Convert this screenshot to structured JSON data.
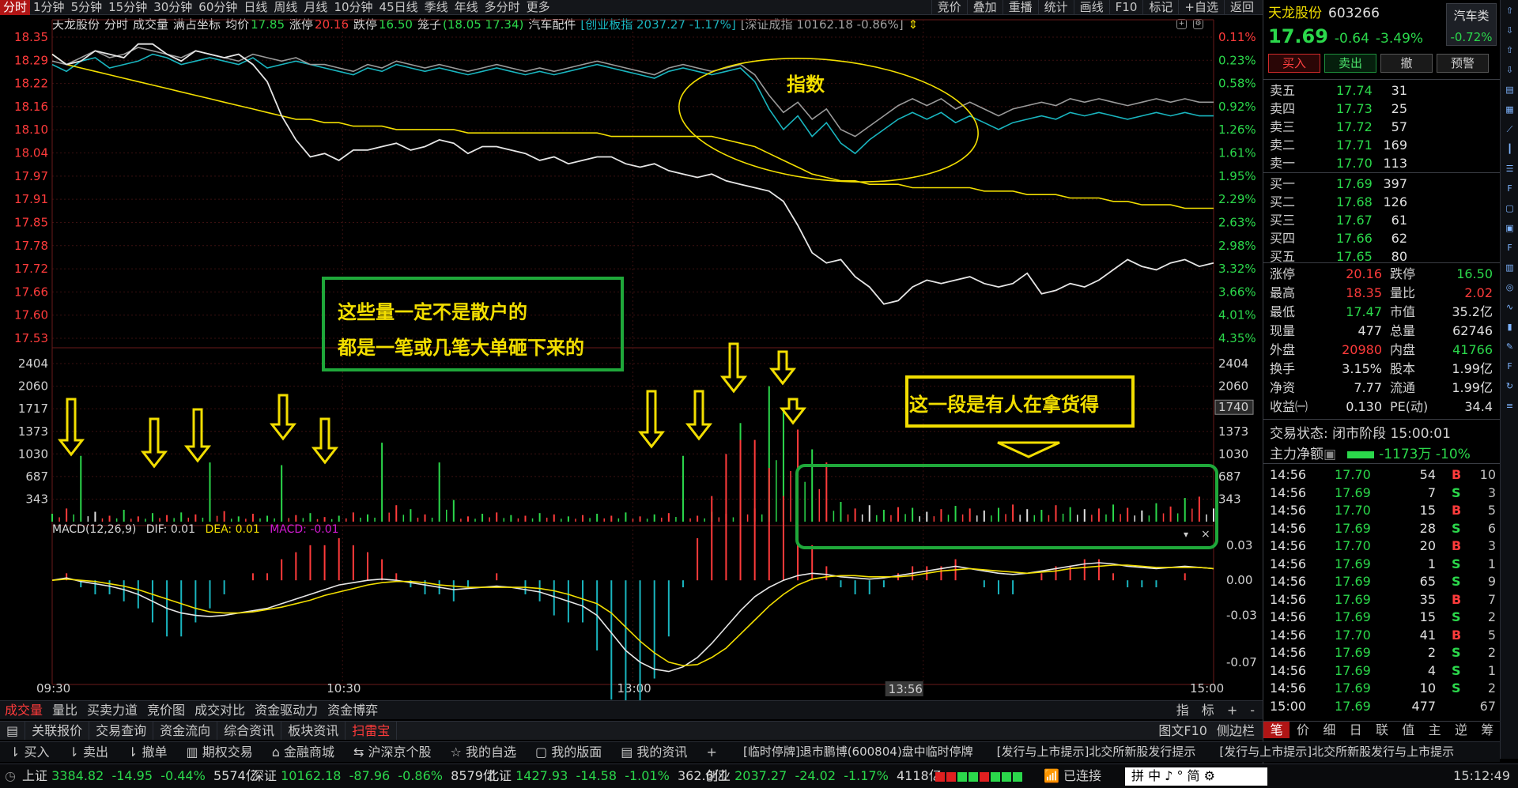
{
  "toolbar": {
    "periods": [
      "分时",
      "1分钟",
      "5分钟",
      "15分钟",
      "30分钟",
      "60分钟",
      "日线",
      "周线",
      "月线",
      "10分钟",
      "45日线",
      "季线",
      "年线",
      "多分时",
      "更多"
    ],
    "active_period": "分时",
    "right_tools": [
      "竞价",
      "叠加",
      "重播",
      "统计",
      "画线",
      "F10",
      "标记",
      "+自选",
      "返回"
    ]
  },
  "info_bar": {
    "stock_name": "天龙股份",
    "mode": "分时",
    "volume_label": "成交量",
    "coord_mode": "满占坐标",
    "avg_label": "均价",
    "avg_value": "17.85",
    "limit_up_label": "涨停",
    "limit_up_value": "20.16",
    "limit_down_label": "跌停",
    "limit_down_value": "16.50",
    "cage_label": "笼子",
    "cage_value": "(18.05 17.34)",
    "sector": "汽车配件",
    "index1": "[创业板指 2037.27 -1.17%]",
    "index2": "[深证成指 10162.18 -0.86%]"
  },
  "chart_data": {
    "type": "line",
    "title": "",
    "price_axis_left": [
      "18.35",
      "18.29",
      "18.22",
      "18.16",
      "18.10",
      "18.04",
      "17.97",
      "17.91",
      "17.85",
      "17.78",
      "17.72",
      "17.66",
      "17.60",
      "17.53"
    ],
    "price_axis_right": [
      "0.11%",
      "0.23%",
      "0.58%",
      "0.92%",
      "1.26%",
      "1.61%",
      "1.95%",
      "2.29%",
      "2.63%",
      "2.98%",
      "3.32%",
      "3.66%",
      "4.01%",
      "4.35%"
    ],
    "volume_axis": [
      "2404",
      "2060",
      "1717",
      "1373",
      "1030",
      "687",
      "343"
    ],
    "volume_cursor": "1740",
    "macd_axis": [
      "0.03",
      "0.00",
      "-0.03",
      "-0.07"
    ],
    "time_axis": [
      "09:30",
      "10:30",
      "13:00",
      "15:00"
    ],
    "cursor_time": "13:56",
    "series": [
      {
        "name": "price",
        "color": "#e6e6e6",
        "values": [
          18.3,
          18.27,
          18.28,
          18.31,
          18.3,
          18.29,
          18.33,
          18.33,
          18.3,
          18.28,
          18.31,
          18.3,
          18.29,
          18.3,
          18.27,
          18.22,
          18.12,
          18.05,
          18.0,
          18.01,
          17.99,
          18.02,
          18.02,
          18.03,
          18.04,
          18.02,
          18.03,
          18.05,
          18.04,
          18.01,
          18.03,
          18.03,
          18.02,
          18.01,
          17.99,
          18.0,
          17.98,
          17.99,
          18.0,
          18.0,
          17.98,
          17.97,
          17.98,
          17.96,
          17.95,
          17.94,
          17.95,
          17.93,
          17.92,
          17.91,
          17.9,
          17.87,
          17.8,
          17.72,
          17.69,
          17.7,
          17.65,
          17.62,
          17.57,
          17.58,
          17.62,
          17.64,
          17.63,
          17.64,
          17.65,
          17.63,
          17.62,
          17.63,
          17.66,
          17.6,
          17.61,
          17.63,
          17.62,
          17.64,
          17.67,
          17.7,
          17.68,
          17.67,
          17.69,
          17.7,
          17.68,
          17.69
        ]
      },
      {
        "name": "avg",
        "color": "#f2de00",
        "values": [
          18.3,
          18.27,
          18.26,
          18.25,
          18.24,
          18.23,
          18.22,
          18.21,
          18.2,
          18.19,
          18.18,
          18.17,
          18.16,
          18.15,
          18.14,
          18.13,
          18.12,
          18.11,
          18.11,
          18.1,
          18.1,
          18.09,
          18.09,
          18.09,
          18.08,
          18.08,
          18.08,
          18.08,
          18.08,
          18.07,
          18.07,
          18.07,
          18.07,
          18.07,
          18.07,
          18.07,
          18.07,
          18.07,
          18.07,
          18.06,
          18.06,
          18.06,
          18.06,
          18.06,
          18.06,
          18.06,
          18.06,
          18.05,
          18.04,
          18.03,
          18.01,
          17.99,
          17.97,
          17.95,
          17.94,
          17.93,
          17.93,
          17.92,
          17.92,
          17.92,
          17.91,
          17.91,
          17.91,
          17.91,
          17.91,
          17.9,
          17.9,
          17.9,
          17.89,
          17.89,
          17.89,
          17.88,
          17.88,
          17.88,
          17.87,
          17.87,
          17.86,
          17.86,
          17.86,
          17.85,
          17.85,
          17.85
        ]
      },
      {
        "name": "index1",
        "color": "#19b5bf",
        "values": [
          18.27,
          18.25,
          18.28,
          18.29,
          18.26,
          18.27,
          18.28,
          18.3,
          18.29,
          18.27,
          18.28,
          18.29,
          18.28,
          18.27,
          18.29,
          18.26,
          18.27,
          18.28,
          18.27,
          18.26,
          18.25,
          18.24,
          18.26,
          18.25,
          18.27,
          18.26,
          18.25,
          18.26,
          18.25,
          18.24,
          18.25,
          18.26,
          18.25,
          18.24,
          18.25,
          18.24,
          18.25,
          18.26,
          18.27,
          18.26,
          18.25,
          18.24,
          18.23,
          18.25,
          18.26,
          18.25,
          18.24,
          18.25,
          18.26,
          18.22,
          18.14,
          18.08,
          18.12,
          18.06,
          18.1,
          18.04,
          18.01,
          18.05,
          18.08,
          18.11,
          18.13,
          18.11,
          18.13,
          18.1,
          18.12,
          18.1,
          18.08,
          18.1,
          18.11,
          18.12,
          18.11,
          18.13,
          18.12,
          18.13,
          18.12,
          18.11,
          18.12,
          18.13,
          18.12,
          18.13,
          18.12,
          18.12
        ]
      },
      {
        "name": "index2",
        "color": "#9a9a9a",
        "values": [
          18.28,
          18.27,
          18.29,
          18.31,
          18.29,
          18.3,
          18.32,
          18.31,
          18.3,
          18.29,
          18.31,
          18.3,
          18.29,
          18.28,
          18.3,
          18.29,
          18.28,
          18.29,
          18.27,
          18.27,
          18.26,
          18.25,
          18.27,
          18.26,
          18.28,
          18.27,
          18.26,
          18.27,
          18.26,
          18.25,
          18.26,
          18.27,
          18.26,
          18.25,
          18.26,
          18.25,
          18.26,
          18.27,
          18.28,
          18.27,
          18.26,
          18.25,
          18.24,
          18.26,
          18.27,
          18.26,
          18.25,
          18.26,
          18.27,
          18.24,
          18.18,
          18.13,
          18.16,
          18.11,
          18.14,
          18.08,
          18.06,
          18.09,
          18.12,
          18.15,
          18.17,
          18.15,
          18.17,
          18.14,
          18.16,
          18.14,
          18.12,
          18.14,
          18.15,
          18.16,
          18.15,
          18.17,
          18.16,
          18.17,
          18.16,
          18.15,
          18.16,
          18.17,
          18.16,
          18.17,
          18.16,
          18.16
        ]
      }
    ],
    "volume": [
      120,
      200,
      1000,
      150,
      90,
      180,
      80,
      130,
      100,
      140,
      110,
      900,
      160,
      80,
      120,
      90,
      860,
      100,
      130,
      70,
      90,
      140,
      110,
      1200,
      250,
      190,
      110,
      900,
      330,
      80,
      120,
      140,
      100,
      90,
      130,
      110,
      80,
      100,
      120,
      90,
      140,
      80,
      110,
      130,
      1000,
      90,
      150,
      120,
      1500,
      200,
      2060,
      1700,
      1400,
      1100,
      900,
      300,
      200,
      250,
      180,
      220,
      210,
      150,
      190,
      240,
      200,
      170,
      210,
      260,
      190,
      180,
      250,
      220,
      190,
      200,
      260,
      210,
      170,
      280,
      230,
      360,
      380,
      200
    ],
    "volume_color": [
      "g",
      "r",
      "g",
      "w",
      "r",
      "g",
      "r",
      "g",
      "r",
      "g",
      "r",
      "g",
      "r",
      "g",
      "r",
      "g",
      "g",
      "r",
      "g",
      "r",
      "g",
      "r",
      "g",
      "g",
      "r",
      "g",
      "r",
      "g",
      "g",
      "r",
      "g",
      "r",
      "g",
      "r",
      "g",
      "r",
      "g",
      "r",
      "g",
      "r",
      "g",
      "r",
      "g",
      "r",
      "g",
      "r",
      "g",
      "r",
      "g",
      "r",
      "g",
      "g",
      "r",
      "g",
      "r",
      "g",
      "r",
      "w",
      "g",
      "r",
      "g",
      "w",
      "r",
      "g",
      "r",
      "w",
      "g",
      "r",
      "w",
      "g",
      "r",
      "g",
      "w",
      "r",
      "g",
      "r",
      "w",
      "g",
      "r",
      "g",
      "r",
      "w"
    ],
    "macd_dif": [
      0.0,
      0.002,
      -0.001,
      -0.003,
      -0.005,
      -0.008,
      -0.012,
      -0.018,
      -0.024,
      -0.028,
      -0.03,
      -0.031,
      -0.03,
      -0.028,
      -0.026,
      -0.024,
      -0.02,
      -0.016,
      -0.012,
      -0.008,
      -0.004,
      -0.002,
      0.0,
      0.001,
      0.0,
      -0.002,
      -0.004,
      -0.006,
      -0.008,
      -0.007,
      -0.006,
      -0.005,
      -0.006,
      -0.008,
      -0.01,
      -0.014,
      -0.018,
      -0.022,
      -0.03,
      -0.045,
      -0.06,
      -0.07,
      -0.076,
      -0.078,
      -0.074,
      -0.066,
      -0.054,
      -0.04,
      -0.026,
      -0.014,
      -0.006,
      0.0,
      0.004,
      0.006,
      0.005,
      0.003,
      0.002,
      0.001,
      0.002,
      0.004,
      0.006,
      0.008,
      0.01,
      0.012,
      0.01,
      0.008,
      0.006,
      0.005,
      0.006,
      0.008,
      0.01,
      0.012,
      0.014,
      0.015,
      0.014,
      0.012,
      0.011,
      0.01,
      0.011,
      0.012,
      0.011,
      0.01
    ],
    "macd_dea": [
      0.0,
      0.001,
      0.0,
      -0.001,
      -0.003,
      -0.005,
      -0.008,
      -0.012,
      -0.016,
      -0.02,
      -0.024,
      -0.027,
      -0.028,
      -0.028,
      -0.027,
      -0.025,
      -0.023,
      -0.02,
      -0.017,
      -0.013,
      -0.01,
      -0.007,
      -0.004,
      -0.002,
      -0.001,
      -0.001,
      -0.002,
      -0.004,
      -0.005,
      -0.006,
      -0.006,
      -0.006,
      -0.006,
      -0.006,
      -0.007,
      -0.009,
      -0.012,
      -0.016,
      -0.02,
      -0.028,
      -0.04,
      -0.052,
      -0.062,
      -0.07,
      -0.073,
      -0.072,
      -0.066,
      -0.058,
      -0.046,
      -0.034,
      -0.022,
      -0.012,
      -0.004,
      0.001,
      0.003,
      0.004,
      0.004,
      0.003,
      0.003,
      0.003,
      0.004,
      0.006,
      0.008,
      0.009,
      0.01,
      0.009,
      0.008,
      0.007,
      0.006,
      0.007,
      0.008,
      0.01,
      0.011,
      0.012,
      0.013,
      0.013,
      0.012,
      0.011,
      0.011,
      0.011,
      0.011,
      0.01
    ]
  },
  "macd_label": {
    "name": "MACD(12,26,9)",
    "dif": "DIF: 0.01",
    "dea": "DEA: 0.01",
    "macd": "MACD: -0.01"
  },
  "annotations": {
    "note1_l1": "这些量一定不是散户的",
    "note1_l2": "都是一笔或几笔大单砸下来的",
    "note2": "这一段是有人在拿货得",
    "index_label": "指数"
  },
  "quote": {
    "name": "天龙股份",
    "code": "603266",
    "sector": "汽车类",
    "sector_pct": "-0.72%",
    "price": "17.69",
    "change": "-0.64",
    "change_pct": "-3.49%",
    "actions": [
      "买入",
      "卖出",
      "撤",
      "预警"
    ],
    "asks": [
      {
        "label": "卖五",
        "price": "17.74",
        "vol": "31"
      },
      {
        "label": "卖四",
        "price": "17.73",
        "vol": "25"
      },
      {
        "label": "卖三",
        "price": "17.72",
        "vol": "57"
      },
      {
        "label": "卖二",
        "price": "17.71",
        "vol": "169"
      },
      {
        "label": "卖一",
        "price": "17.70",
        "vol": "113"
      }
    ],
    "bids": [
      {
        "label": "买一",
        "price": "17.69",
        "vol": "397"
      },
      {
        "label": "买二",
        "price": "17.68",
        "vol": "126"
      },
      {
        "label": "买三",
        "price": "17.67",
        "vol": "61"
      },
      {
        "label": "买四",
        "price": "17.66",
        "vol": "62"
      },
      {
        "label": "买五",
        "price": "17.65",
        "vol": "80"
      }
    ],
    "stats": [
      {
        "l1": "涨停",
        "v1": "20.16",
        "c1": "r",
        "l2": "跌停",
        "v2": "16.50",
        "c2": "g"
      },
      {
        "l1": "最高",
        "v1": "18.35",
        "c1": "r",
        "l2": "量比",
        "v2": "2.02",
        "c2": "r"
      },
      {
        "l1": "最低",
        "v1": "17.47",
        "c1": "g",
        "l2": "市值",
        "v2": "35.2亿",
        "c2": "w"
      },
      {
        "l1": "现量",
        "v1": "477",
        "c1": "w",
        "l2": "总量",
        "v2": "62746",
        "c2": "w"
      },
      {
        "l1": "外盘",
        "v1": "20980",
        "c1": "r",
        "l2": "内盘",
        "v2": "41766",
        "c2": "g"
      },
      {
        "l1": "换手",
        "v1": "3.15%",
        "c1": "w",
        "l2": "股本",
        "v2": "1.99亿",
        "c2": "w"
      },
      {
        "l1": "净资",
        "v1": "7.77",
        "c1": "w",
        "l2": "流通",
        "v2": "1.99亿",
        "c2": "w"
      },
      {
        "l1": "收益㈠",
        "v1": "0.130",
        "c1": "w",
        "l2": "PE(动)",
        "v2": "34.4",
        "c2": "w"
      }
    ],
    "status": "交易状态: 闭市阶段 15:00:01",
    "flow_label": "主力净额",
    "flow_value": "-1173万",
    "flow_pct": "-10%",
    "ticks": [
      {
        "t": "14:56",
        "p": "17.70",
        "c": "g",
        "v": "54",
        "d": "B",
        "n": "10"
      },
      {
        "t": "14:56",
        "p": "17.69",
        "c": "g",
        "v": "7",
        "d": "S",
        "n": "3"
      },
      {
        "t": "14:56",
        "p": "17.70",
        "c": "g",
        "v": "15",
        "d": "B",
        "n": "5"
      },
      {
        "t": "14:56",
        "p": "17.69",
        "c": "g",
        "v": "28",
        "d": "S",
        "n": "6"
      },
      {
        "t": "14:56",
        "p": "17.70",
        "c": "g",
        "v": "20",
        "d": "B",
        "n": "3"
      },
      {
        "t": "14:56",
        "p": "17.69",
        "c": "g",
        "v": "1",
        "d": "S",
        "n": "1"
      },
      {
        "t": "14:56",
        "p": "17.69",
        "c": "g",
        "v": "65",
        "d": "S",
        "n": "9"
      },
      {
        "t": "14:56",
        "p": "17.69",
        "c": "g",
        "v": "35",
        "d": "B",
        "n": "7"
      },
      {
        "t": "14:56",
        "p": "17.69",
        "c": "g",
        "v": "15",
        "d": "S",
        "n": "2"
      },
      {
        "t": "14:56",
        "p": "17.70",
        "c": "g",
        "v": "41",
        "d": "B",
        "n": "5"
      },
      {
        "t": "14:56",
        "p": "17.69",
        "c": "g",
        "v": "2",
        "d": "S",
        "n": "2"
      },
      {
        "t": "14:56",
        "p": "17.69",
        "c": "g",
        "v": "4",
        "d": "S",
        "n": "1"
      },
      {
        "t": "14:56",
        "p": "17.69",
        "c": "g",
        "v": "10",
        "d": "S",
        "n": "2"
      },
      {
        "t": "15:00",
        "p": "17.69",
        "c": "g",
        "v": "477",
        "d": "",
        "n": "67"
      }
    ],
    "bottom_tabs": [
      "笔",
      "价",
      "细",
      "日",
      "联",
      "值",
      "主",
      "逆",
      "筹"
    ]
  },
  "bottom_tabs": {
    "items": [
      "成交量",
      "量比",
      "买卖力道",
      "竞价图",
      "成交对比",
      "资金驱动力",
      "资金博弈"
    ],
    "right": [
      "指",
      "标",
      "+",
      "-"
    ]
  },
  "service_bar": {
    "items": [
      "关联报价",
      "交易查询",
      "资金流向",
      "综合资讯",
      "板块资讯",
      "扫雷宝"
    ],
    "right": [
      "图文F10",
      "侧边栏"
    ]
  },
  "trade_bar": {
    "items": [
      "买入",
      "卖出",
      "撤单",
      "期权交易",
      "金融商城",
      "沪深京个股",
      "我的自选",
      "我的版面",
      "我的资讯"
    ],
    "news": [
      "[临时停牌]退市鹏博(600804)盘中临时停牌",
      "[发行与上市提示]北交所新股发行提示",
      "[发行与上市提示]北交所新股发行与上市提示"
    ]
  },
  "status_bar": {
    "sh": {
      "name": "上证",
      "value": "3384.82",
      "chg": "-14.95",
      "pct": "-0.44%",
      "amt": "5574亿"
    },
    "sz": {
      "name": "深证",
      "value": "10162.18",
      "chg": "-87.96",
      "pct": "-0.86%",
      "amt": "8579亿"
    },
    "bz": {
      "name": "北证",
      "value": "1427.93",
      "chg": "-14.58",
      "pct": "-1.01%",
      "amt": "362.6亿"
    },
    "cy": {
      "name": "创业",
      "value": "2037.27",
      "chg": "-24.02",
      "pct": "-1.17%",
      "amt": "4118亿"
    },
    "conn": "已连接",
    "ime": "拼 中 ♪ ° 简 ⚙",
    "clock": "15:12:49"
  },
  "colors": {
    "up": "#ff3b3b",
    "down": "#2bd84b",
    "accent": "#f2de00",
    "index": "#19b5bf",
    "box": "#1fa83a"
  }
}
